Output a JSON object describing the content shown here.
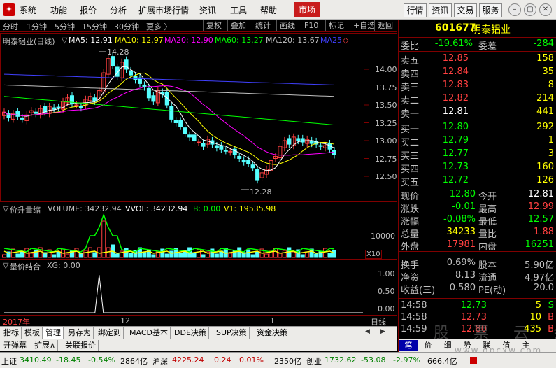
{
  "menu": {
    "items": [
      "系统",
      "功能",
      "报价",
      "分析",
      "扩展市场行情",
      "资讯",
      "工具",
      "帮助"
    ],
    "market": "市场",
    "right_buttons": [
      "行情",
      "资讯",
      "交易",
      "服务"
    ]
  },
  "period_bar": {
    "periods": [
      "分时",
      "1分钟",
      "5分钟",
      "15分钟",
      "30分钟",
      "更多 〉"
    ],
    "tools": [
      "复权",
      "叠加",
      "统计",
      "画线",
      "F10",
      "标记",
      "+自选",
      "返回"
    ]
  },
  "main_chart": {
    "title": "明泰铝业(日线)",
    "ma": [
      {
        "label": "MA5: 12.91",
        "color": "#ffffff"
      },
      {
        "label": "MA10: 12.97",
        "color": "#ffff00"
      },
      {
        "label": "MA20: 12.90",
        "color": "#ff00ff"
      },
      {
        "label": "MA60: 13.27",
        "color": "#00ff00"
      },
      {
        "label": "MA120: 13.67",
        "color": "#c0c0c0"
      },
      {
        "label": "MA25",
        "color": "#4040ff"
      }
    ],
    "price_axis": [
      "14.00",
      "13.75",
      "13.50",
      "13.25",
      "13.00",
      "12.75",
      "12.50"
    ],
    "high_label": "14.28",
    "low_label": "12.28"
  },
  "volume_chart": {
    "title": "价升量缩",
    "volume": "VOLUME: 34232.94",
    "vvol": "VVOL: 34232.94",
    "b": "B: 0.00",
    "v1": "V1: 19535.98",
    "axis": [
      "10000"
    ],
    "unit": "X10"
  },
  "xg_chart": {
    "title": "量价结合",
    "xg": "XG: 0.00",
    "axis": [
      "1.00",
      "0.50",
      "0.00"
    ]
  },
  "x_axis": {
    "year": "2017年",
    "m1": "12",
    "m2": "1",
    "period": "日线"
  },
  "bottom_tabs": [
    "指标",
    "模板",
    "管理",
    "另存为",
    "绑定到",
    "MACD基本",
    "DDE决策",
    "SUP决策",
    "资金决策"
  ],
  "bottom_tabs2": [
    "开弹幕",
    "扩展∧",
    "关联报价"
  ],
  "quote": {
    "code": "601677",
    "name": "明泰铝业",
    "webi_label": "委比",
    "webi": "-19.61%",
    "weicha_label": "委差",
    "weicha": "-284",
    "sells": [
      {
        "label": "卖五",
        "price": "12.85",
        "vol": "158"
      },
      {
        "label": "卖四",
        "price": "12.84",
        "vol": "35"
      },
      {
        "label": "卖三",
        "price": "12.83",
        "vol": "8"
      },
      {
        "label": "卖二",
        "price": "12.82",
        "vol": "214"
      },
      {
        "label": "卖一",
        "price": "12.81",
        "vol": "441"
      }
    ],
    "buys": [
      {
        "label": "买一",
        "price": "12.80",
        "vol": "292"
      },
      {
        "label": "买二",
        "price": "12.79",
        "vol": "1"
      },
      {
        "label": "买三",
        "price": "12.77",
        "vol": "3"
      },
      {
        "label": "买四",
        "price": "12.73",
        "vol": "160"
      },
      {
        "label": "买五",
        "price": "12.72",
        "vol": "126"
      }
    ],
    "stats": [
      {
        "l1": "现价",
        "v1": "12.80",
        "c1": "#00ff00",
        "l2": "今开",
        "v2": "12.81",
        "c2": "#ffffff"
      },
      {
        "l1": "涨跌",
        "v1": "-0.01",
        "c1": "#00ff00",
        "l2": "最高",
        "v2": "12.99",
        "c2": "#ff4040"
      },
      {
        "l1": "涨幅",
        "v1": "-0.08%",
        "c1": "#00ff00",
        "l2": "最低",
        "v2": "12.57",
        "c2": "#00ff00"
      },
      {
        "l1": "总量",
        "v1": "34233",
        "c1": "#ffff00",
        "l2": "量比",
        "v2": "1.88",
        "c2": "#ff4040"
      },
      {
        "l1": "外盘",
        "v1": "17981",
        "c1": "#ff4040",
        "l2": "内盘",
        "v2": "16251",
        "c2": "#00ff00"
      }
    ],
    "stats2": [
      {
        "l1": "换手",
        "v1": "0.69%",
        "l2": "股本",
        "v2": "5.90亿"
      },
      {
        "l1": "净资",
        "v1": "8.13",
        "l2": "流通",
        "v2": "4.97亿"
      },
      {
        "l1": "收益(三)",
        "v1": "0.580",
        "l2": "PE(动)",
        "v2": "20.0"
      }
    ],
    "ticks": [
      {
        "time": "14:58",
        "price": "12.73",
        "vol": "5",
        "flag": "S",
        "color": "#00ff00"
      },
      {
        "time": "14:58",
        "price": "12.73",
        "vol": "10",
        "flag": "B",
        "color": "#ff4040"
      },
      {
        "time": "14:59",
        "price": "12.80",
        "vol": "435",
        "flag": "B",
        "color": "#ff4040"
      }
    ],
    "tabs": [
      "笔",
      "价",
      "细",
      "势",
      "联",
      "值",
      "主"
    ]
  },
  "status": {
    "sh_label": "上证",
    "sh_value": "3410.49",
    "sh_change": "-18.45",
    "sh_pct": "-0.54%",
    "sh_amount": "2864亿",
    "sz_label": "沪深",
    "sz_value": "4225.24",
    "sz_change": "0.24",
    "sz_pct": "0.01%",
    "sz_amount": "2350亿",
    "cy_label": "创业",
    "cy_value": "1732.62",
    "cy_change": "-53.08",
    "cy_pct": "-2.97%",
    "cy_amount": "666.4亿"
  },
  "watermark": {
    "line1": "股 票 云 会",
    "line2": "www.gpcxw.com"
  },
  "colors": {
    "up": "#ff4040",
    "down": "#00ff00",
    "candle_down": "#54ffff",
    "grid": "#800000"
  }
}
